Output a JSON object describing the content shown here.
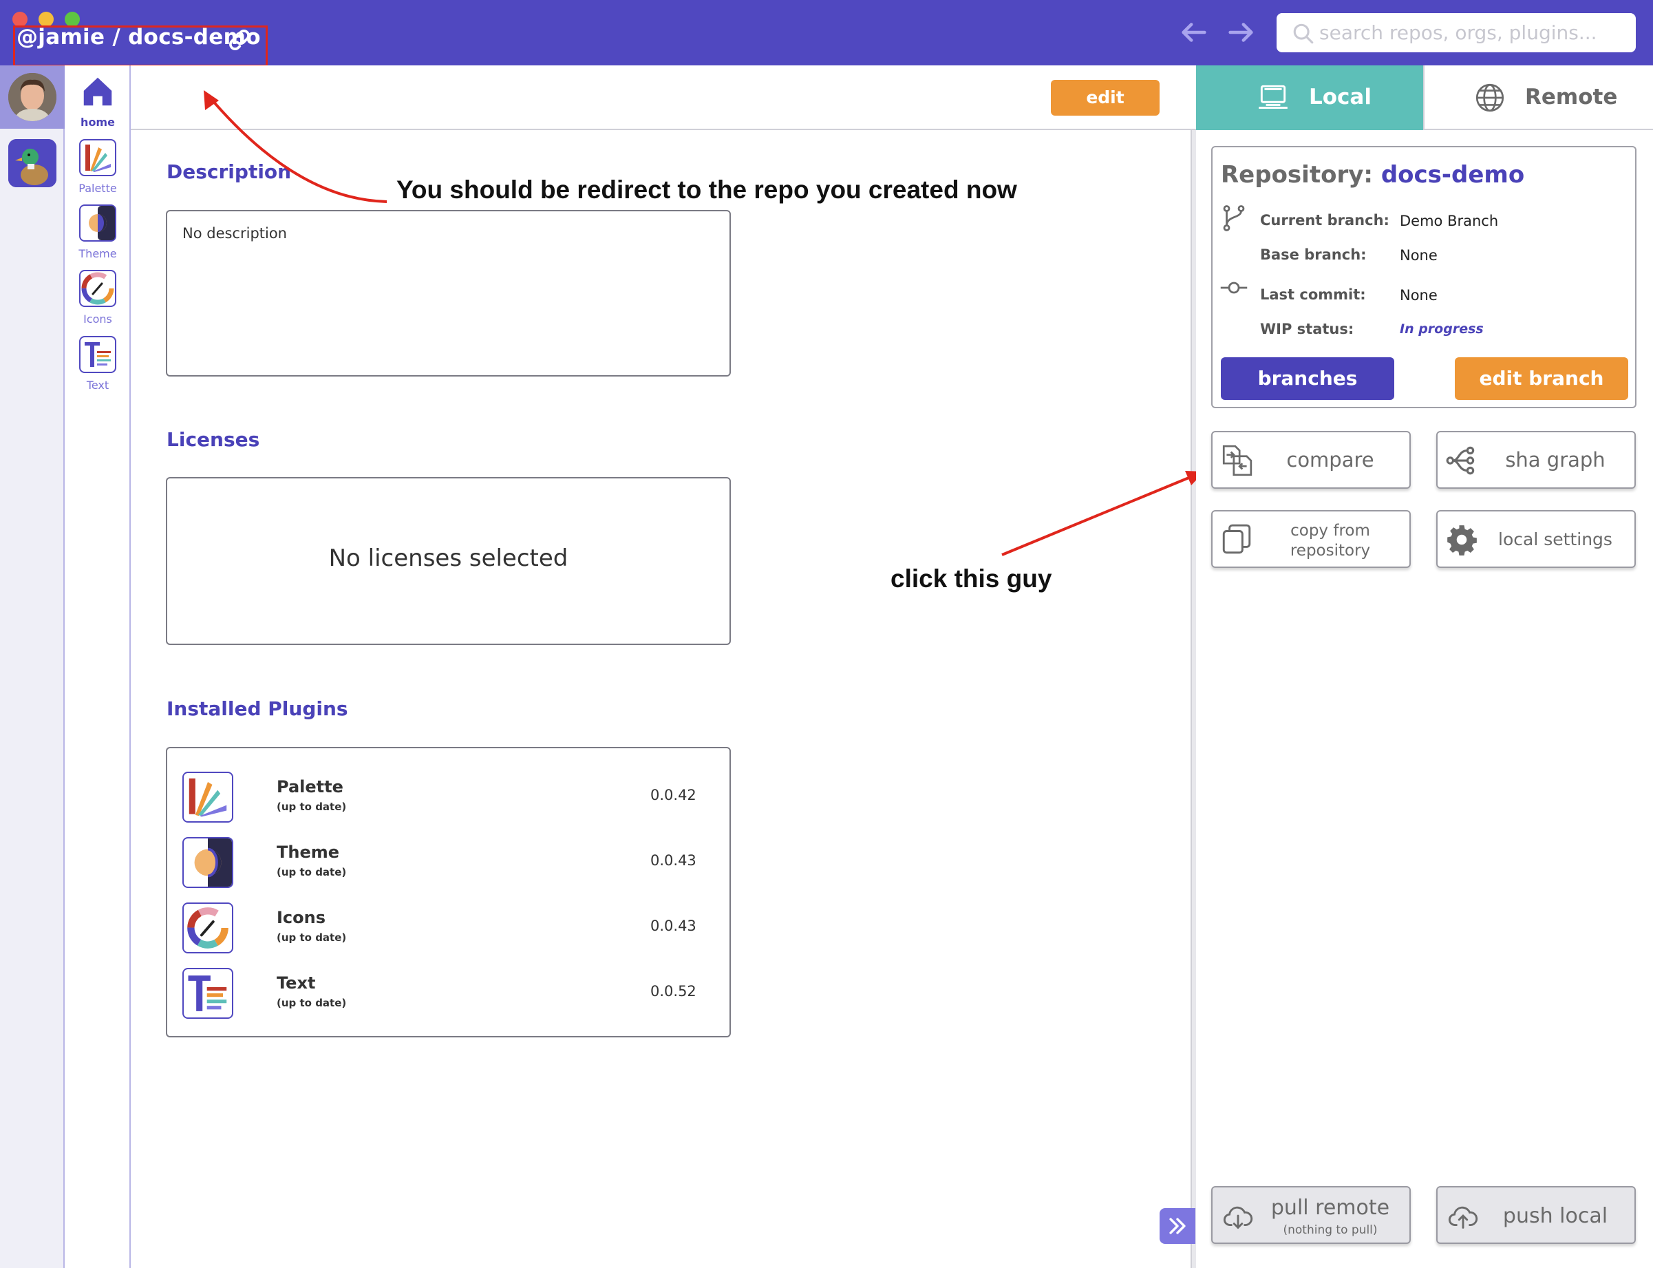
{
  "window": {
    "title": "@jamie / docs-demo"
  },
  "search": {
    "placeholder": "search repos, orgs, plugins..."
  },
  "plugin_rail": [
    {
      "label": "home",
      "icon": "home-icon"
    },
    {
      "label": "Palette",
      "icon": "palette-icon"
    },
    {
      "label": "Theme",
      "icon": "theme-icon"
    },
    {
      "label": "Icons",
      "icon": "icons-icon"
    },
    {
      "label": "Text",
      "icon": "text-icon"
    }
  ],
  "toolbar": {
    "edit_label": "edit"
  },
  "main": {
    "description_heading": "Description",
    "description_text": "No description",
    "licenses_heading": "Licenses",
    "licenses_empty": "No licenses selected",
    "plugins_heading": "Installed Plugins",
    "plugins": [
      {
        "name": "Palette",
        "status": "(up to date)",
        "version": "0.0.42"
      },
      {
        "name": "Theme",
        "status": "(up to date)",
        "version": "0.0.43"
      },
      {
        "name": "Icons",
        "status": "(up to date)",
        "version": "0.0.43"
      },
      {
        "name": "Text",
        "status": "(up to date)",
        "version": "0.0.52"
      }
    ]
  },
  "annotations": {
    "redirect_note": "You should be redirect to the repo you created now",
    "click_note": "click this guy",
    "arrow_color": "#e0261c"
  },
  "right_panel": {
    "tabs": [
      {
        "label": "Local",
        "active": true
      },
      {
        "label": "Remote",
        "active": false
      }
    ],
    "repo_label": "Repository:",
    "repo_name": "docs-demo",
    "current_branch_label": "Current branch:",
    "current_branch_value": "Demo Branch",
    "base_branch_label": "Base branch:",
    "base_branch_value": "None",
    "last_commit_label": "Last commit:",
    "last_commit_value": "None",
    "wip_label": "WIP status:",
    "wip_value": "In progress",
    "branches_label": "branches",
    "edit_branch_label": "edit branch",
    "compare_label": "compare",
    "sha_graph_label": "sha graph",
    "copy_label_1": "copy from",
    "copy_label_2": "repository",
    "local_settings_label": "local settings",
    "pull_label": "pull remote",
    "pull_sub": "(nothing to pull)",
    "push_label": "push local"
  },
  "colors": {
    "brand": "#5048c0",
    "accent_orange": "#ee9635",
    "local_tab": "#5dbfb8"
  }
}
